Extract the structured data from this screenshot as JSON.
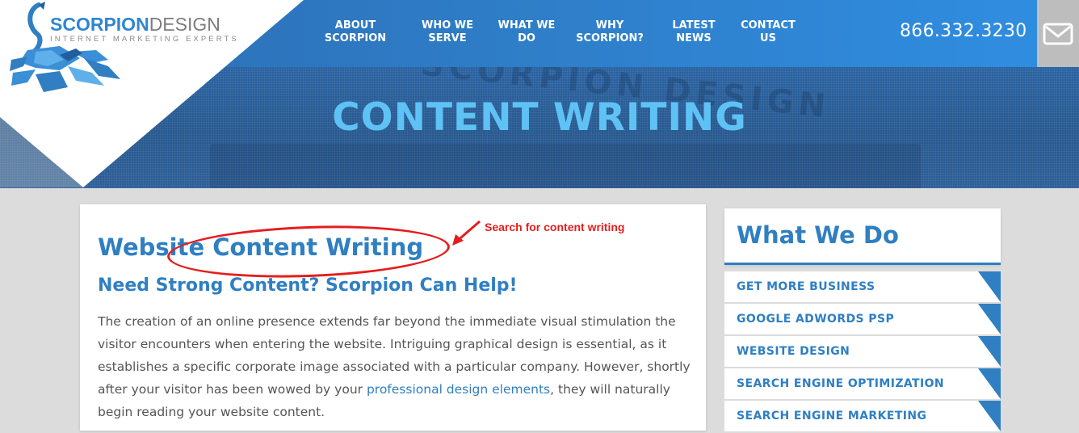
{
  "brand": {
    "name_part1": "SCORPION",
    "name_part2": "DESIGN",
    "tagline": "INTERNET MARKETING EXPERTS"
  },
  "nav": {
    "items": [
      {
        "line1": "ABOUT",
        "line2": "SCORPION"
      },
      {
        "line1": "WHO WE",
        "line2": "SERVE"
      },
      {
        "line1": "WHAT WE",
        "line2": "DO"
      },
      {
        "line1": "WHY",
        "line2": "SCORPION?"
      },
      {
        "line1": "LATEST",
        "line2": "NEWS"
      },
      {
        "line1": "CONTACT",
        "line2": "US"
      }
    ],
    "phone": "866.332.3230",
    "mail_icon": "envelope-icon"
  },
  "hero": {
    "title": "CONTENT WRITING",
    "background_text": "SCORPION DESIGN"
  },
  "article": {
    "heading": "Website Content Writing",
    "subheading": "Need Strong Content? Scorpion Can Help!",
    "paragraph_before_link": "The creation of an online presence extends far beyond the immediate visual stimulation the visitor encounters when entering the website. Intriguing graphical design is essential, as it establishes a specific corporate image associated with a particular company. However, shortly after your visitor has been wowed by your ",
    "link_text": "professional design elements",
    "paragraph_after_link": ", they will naturally begin reading your website content."
  },
  "annotation": {
    "text": "Search for content writing",
    "color": "#e41e1e"
  },
  "sidebar": {
    "title": "What We Do",
    "items": [
      "GET MORE BUSINESS",
      "GOOGLE ADWORDS PSP",
      "WEBSITE DESIGN",
      "SEARCH ENGINE OPTIMIZATION",
      "SEARCH ENGINE MARKETING"
    ]
  },
  "colors": {
    "brand_blue": "#2f7fc2",
    "hero_title": "#5fc2f5",
    "header_gradient_start": "#2b6db3",
    "header_gradient_end": "#2f8de0"
  }
}
